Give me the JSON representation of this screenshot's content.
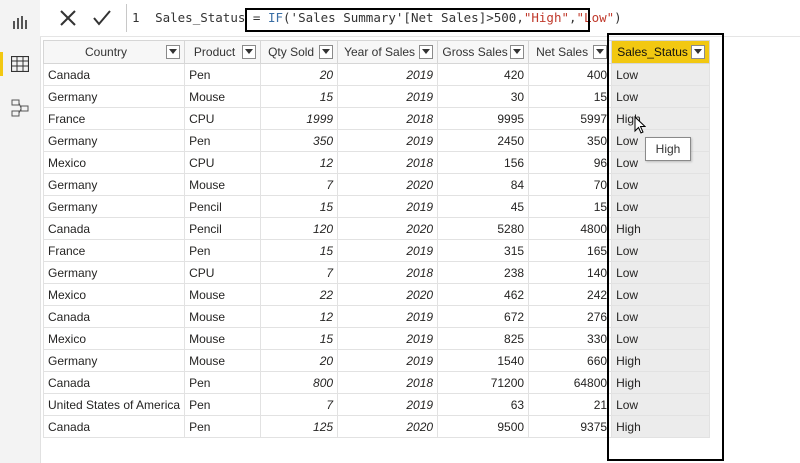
{
  "formula": {
    "line_number": "1",
    "measure_name": "Sales_Status",
    "equals": " = ",
    "fn_name": "IF",
    "paren_open": "(",
    "condition": "'Sales Summary'[Net Sales]>500,",
    "true_value": "\"High\"",
    "comma": ",",
    "false_value": "\"Low\"",
    "paren_close": ")"
  },
  "table": {
    "headers": [
      "Country",
      "Product",
      "Qty Sold",
      "Year of Sales",
      "Gross Sales",
      "Net Sales",
      "Sales_Status"
    ],
    "rows": [
      [
        "Canada",
        "Pen",
        "20",
        "2019",
        "420",
        "400",
        "Low"
      ],
      [
        "Germany",
        "Mouse",
        "15",
        "2019",
        "30",
        "15",
        "Low"
      ],
      [
        "France",
        "CPU",
        "1999",
        "2018",
        "9995",
        "5997",
        "High"
      ],
      [
        "Germany",
        "Pen",
        "350",
        "2019",
        "2450",
        "350",
        "Low"
      ],
      [
        "Mexico",
        "CPU",
        "12",
        "2018",
        "156",
        "96",
        "Low"
      ],
      [
        "Germany",
        "Mouse",
        "7",
        "2020",
        "84",
        "70",
        "Low"
      ],
      [
        "Germany",
        "Pencil",
        "15",
        "2019",
        "45",
        "15",
        "Low"
      ],
      [
        "Canada",
        "Pencil",
        "120",
        "2020",
        "5280",
        "4800",
        "High"
      ],
      [
        "France",
        "Pen",
        "15",
        "2019",
        "315",
        "165",
        "Low"
      ],
      [
        "Germany",
        "CPU",
        "7",
        "2018",
        "238",
        "140",
        "Low"
      ],
      [
        "Mexico",
        "Mouse",
        "22",
        "2020",
        "462",
        "242",
        "Low"
      ],
      [
        "Canada",
        "Mouse",
        "12",
        "2019",
        "672",
        "276",
        "Low"
      ],
      [
        "Mexico",
        "Mouse",
        "15",
        "2019",
        "825",
        "330",
        "Low"
      ],
      [
        "Germany",
        "Mouse",
        "20",
        "2019",
        "1540",
        "660",
        "High"
      ],
      [
        "Canada",
        "Pen",
        "800",
        "2018",
        "71200",
        "64800",
        "High"
      ],
      [
        "United States of America",
        "Pen",
        "7",
        "2019",
        "63",
        "21",
        "Low"
      ],
      [
        "Canada",
        "Pen",
        "125",
        "2020",
        "9500",
        "9375",
        "High"
      ]
    ]
  },
  "tooltip": {
    "text": "High"
  },
  "colors": {
    "accent": "#f2c811",
    "highlight_border": "#000000"
  },
  "icons": {
    "report_view": "bar-chart-icon",
    "data_view": "table-grid-icon",
    "model_view": "model-diagram-icon",
    "cancel": "x-icon",
    "commit": "check-icon"
  }
}
